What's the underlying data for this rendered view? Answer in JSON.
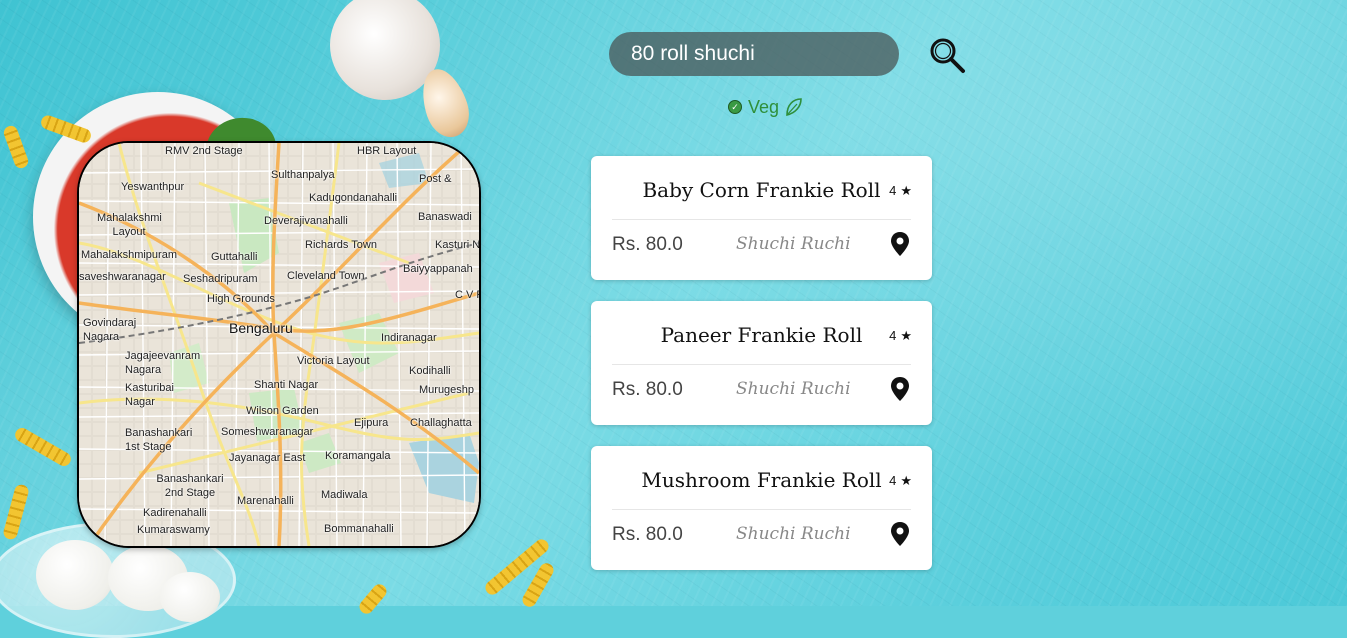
{
  "search": {
    "value": "80 roll shuchi"
  },
  "filter": {
    "label": "Veg"
  },
  "map": {
    "labels": [
      "RMV 2nd Stage",
      "HBR Layout",
      "Sulthanpalya",
      "Post &",
      "Yeswanthpur",
      "Kadugondanahalli",
      "Mahalakshmi Layout",
      "Deverajivanahalli",
      "Banaswadi",
      "Guttahalli",
      "Richards Town",
      "Kasturi N",
      "Mahalakshmipuram",
      "Seshadripuram",
      "Baiyyappanah",
      "saveshwaranagar",
      "Cleveland Town",
      "C V R",
      "High Grounds",
      "Govindaraj Nagara",
      "Bengaluru",
      "Indiranagar",
      "Jagajeevanram Nagara",
      "Victoria Layout",
      "Kodihalli",
      "Kasturibai Nagar",
      "Shanti Nagar",
      "Murugeshp",
      "Wilson Garden",
      "Banashankari 1st Stage",
      "Someshwaranagar",
      "Ejipura",
      "Challaghatta",
      "Jayanagar East",
      "Koramangala",
      "Banashankari 2nd Stage",
      "Marenahalli",
      "Kadirenahalli",
      "Madiwala",
      "Kumaraswamy",
      "Bommanahalli"
    ]
  },
  "results": [
    {
      "name": "Baby Corn Frankie Roll",
      "rating": "4",
      "price": "Rs. 80.0",
      "shop": "Shuchi Ruchi"
    },
    {
      "name": "Paneer Frankie Roll",
      "rating": "4",
      "price": "Rs. 80.0",
      "shop": "Shuchi Ruchi"
    },
    {
      "name": "Mushroom Frankie Roll",
      "rating": "4",
      "price": "Rs. 80.0",
      "shop": "Shuchi Ruchi"
    }
  ],
  "icons": {
    "search": "search-icon",
    "veg": "check-circle-icon",
    "leaf": "leaf-icon",
    "star": "star-icon",
    "pin": "map-pin-icon"
  },
  "colors": {
    "background": "#5fd0dc",
    "veg_green": "#2e8f3a",
    "search_bg": "#4b5454"
  }
}
